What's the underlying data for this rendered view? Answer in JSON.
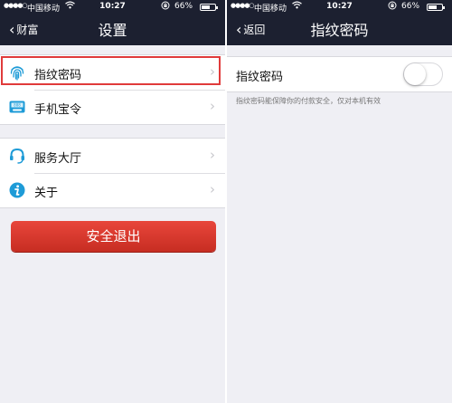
{
  "status_bar": {
    "signal": "●●●●○",
    "carrier": "中国移动",
    "time": "10:27",
    "battery_pct": "66%",
    "battery_level": 0.66
  },
  "left": {
    "back_label": "财富",
    "title": "设置",
    "group1": [
      {
        "label": "指纹密码",
        "icon": "fingerprint-icon"
      },
      {
        "label": "手机宝令",
        "icon": "token-icon"
      }
    ],
    "group2": [
      {
        "label": "服务大厅",
        "icon": "headset-icon"
      },
      {
        "label": "关于",
        "icon": "info-icon"
      }
    ],
    "logout_label": "安全退出"
  },
  "right": {
    "back_label": "返回",
    "title": "指纹密码",
    "toggle_label": "指纹密码",
    "toggle_on": false,
    "hint": "指纹密码能保障你的付款安全，仅对本机有效"
  },
  "colors": {
    "navbar": "#1c2030",
    "logout": "#d63a2f",
    "highlight": "#e03b3b",
    "icon_blue": "#1e9bd7"
  }
}
